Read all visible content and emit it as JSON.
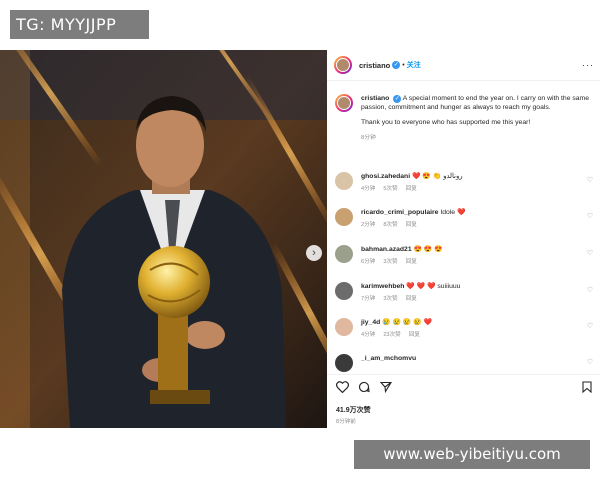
{
  "watermark_top": "TG: MYYJJPP",
  "watermark_bottom": "www.web-yibeitiyu.com",
  "post": {
    "username": "cristiano",
    "follow_label": "关注",
    "more_icon": "more-icon",
    "caption_line1": "A special moment to end the year on. I carry on with the same passion, commitment and hunger as always to reach my goals.",
    "caption_line2": "Thank you to everyone who has supported me this year!",
    "caption_time": "8分钟",
    "likes": "41.9万次赞",
    "time": "8分钟前"
  },
  "comments": [
    {
      "user": "ghosi.zahedani",
      "text": "❤️ 😍 👏 رونالدو",
      "time": "4分钟",
      "likes": "5次赞",
      "reply": "回复",
      "color": "#d9c4a8"
    },
    {
      "user": "ricardo_crimi_populaire",
      "text": "Idole ❤️",
      "time": "2分钟",
      "likes": "8次赞",
      "reply": "回复",
      "color": "#c9a070"
    },
    {
      "user": "bahman.azad21",
      "text": "😍 😍 😍",
      "time": "6分钟",
      "likes": "3次赞",
      "reply": "回复",
      "color": "#9aa08c"
    },
    {
      "user": "karimwehbeh",
      "text": "❤️ ❤️ ❤️ suiiiuuu",
      "time": "7分钟",
      "likes": "3次赞",
      "reply": "回复",
      "color": "#6c6c6c"
    },
    {
      "user": "jiy_4d",
      "text": "😢 😢 😢 😢 ❤️",
      "time": "4分钟",
      "likes": "23次赞",
      "reply": "回复",
      "color": "#e0b8a0"
    },
    {
      "user": "_i_am_mchomvu",
      "text": "",
      "time": "",
      "likes": "",
      "reply": "",
      "color": "#3a3a3a"
    }
  ]
}
